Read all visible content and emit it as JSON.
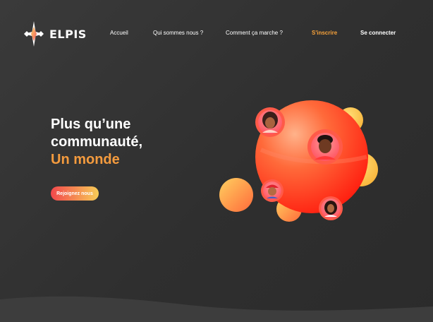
{
  "brand": {
    "name": "ELPIS"
  },
  "nav": {
    "items": [
      {
        "label": "Accueil"
      },
      {
        "label": "Qui sommes nous ?"
      },
      {
        "label": "Comment ça marche ?"
      }
    ],
    "signup_label": "S'inscrire",
    "login_label": "Se connecter"
  },
  "hero": {
    "title_line1": "Plus qu’une",
    "title_line2": "communauté,",
    "title_accent": "Un monde",
    "cta_label": "Rejoignez nous"
  },
  "colors": {
    "background": "#333333",
    "accent": "#f49b3e",
    "gradient_start": "#f2474c",
    "gradient_end": "#f7cc57"
  },
  "illustration": {
    "avatars": [
      "avatar-woman-curly-hair",
      "avatar-man-curly-hair",
      "avatar-man-red-cap",
      "avatar-woman-long-hair"
    ]
  }
}
